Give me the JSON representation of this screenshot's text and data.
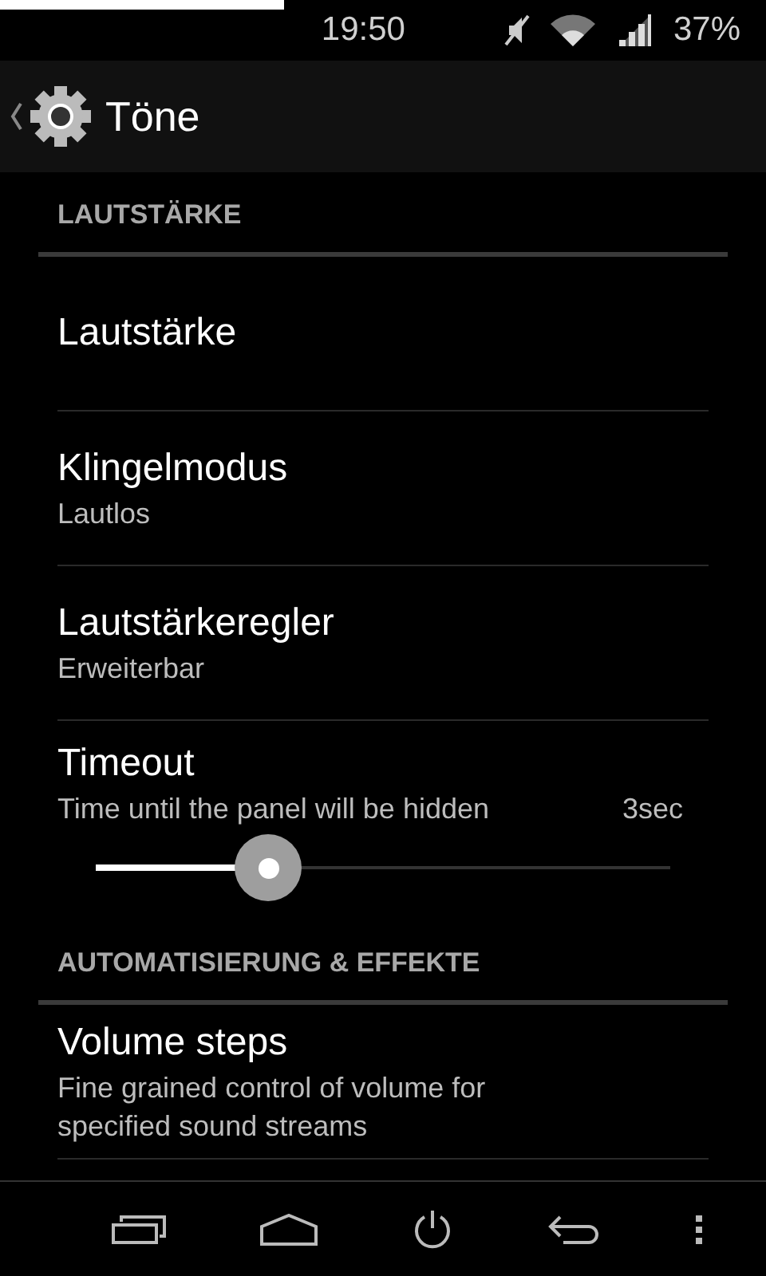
{
  "status_bar": {
    "time": "19:50",
    "battery": "37%"
  },
  "action_bar": {
    "title": "Töne"
  },
  "sections": [
    {
      "header": "LAUTSTÄRKE",
      "items": [
        {
          "kind": "plain",
          "title": "Lautstärke"
        },
        {
          "kind": "plain",
          "title": "Klingelmodus",
          "summary": "Lautlos"
        },
        {
          "kind": "plain",
          "title": "Lautstärkeregler",
          "summary": "Erweiterbar"
        },
        {
          "kind": "slider",
          "title": "Timeout",
          "summary": "Time until the panel will be hidden",
          "reading": "3sec",
          "level": 0.3
        }
      ]
    },
    {
      "header": "AUTOMATISIERUNG & EFFEKTE",
      "items": [
        {
          "kind": "plain",
          "title": "Volume steps",
          "summary": "Fine grained control of volume for specified sound streams"
        }
      ]
    }
  ]
}
